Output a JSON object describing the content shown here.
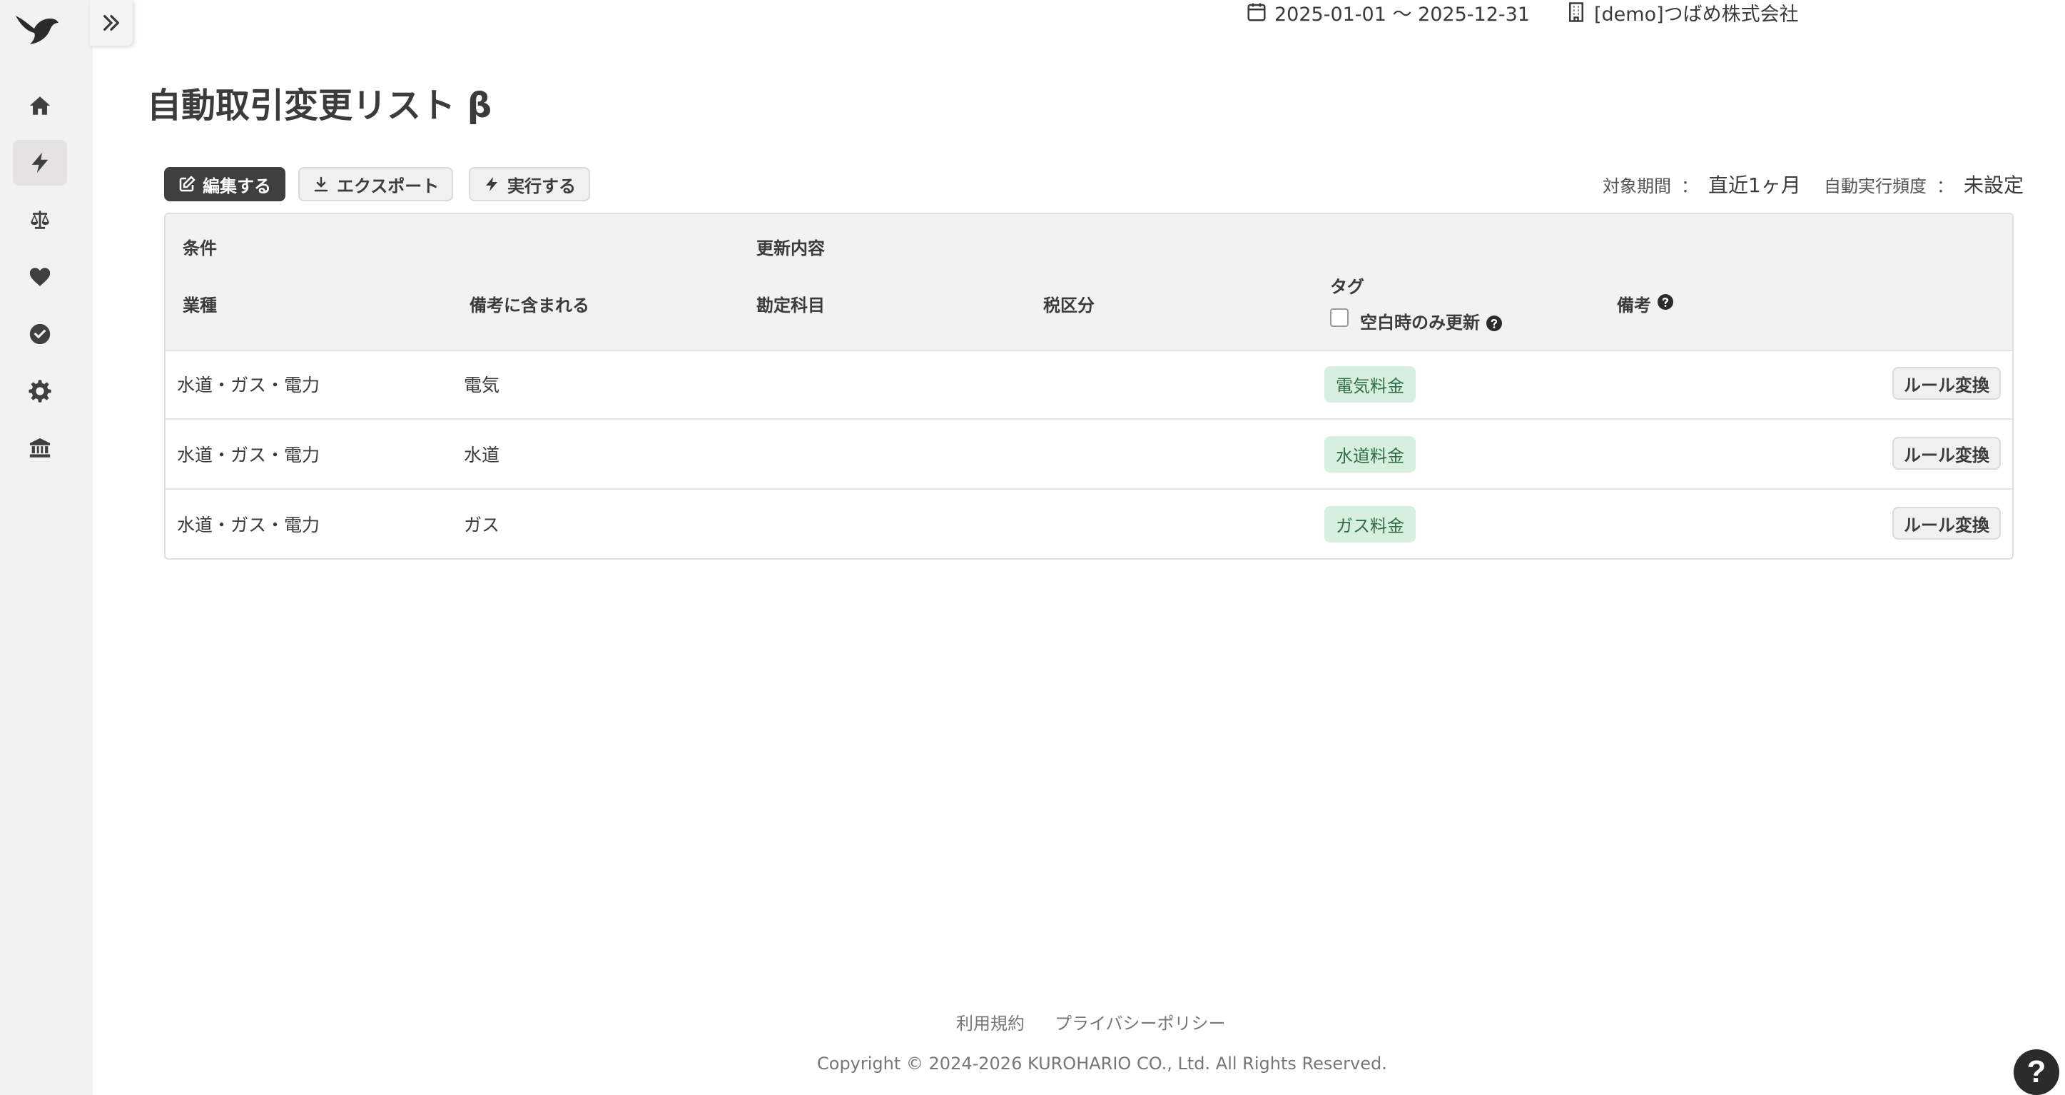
{
  "header": {
    "period": "2025-01-01 〜 2025-12-31",
    "company": "[demo]つばめ株式会社"
  },
  "sidebar": {
    "items": [
      {
        "icon": "home-icon"
      },
      {
        "icon": "lightning-icon",
        "active": true
      },
      {
        "icon": "scale-icon"
      },
      {
        "icon": "heart-icon"
      },
      {
        "icon": "check-circle-icon"
      },
      {
        "icon": "gear-icon"
      },
      {
        "icon": "bank-icon"
      }
    ]
  },
  "page": {
    "title": "自動取引変更リスト β"
  },
  "toolbar": {
    "edit_label": "編集する",
    "export_label": "エクスポート",
    "run_label": "実行する"
  },
  "meta": {
    "period_label": "対象期間",
    "period_sep": "：",
    "period_value": "直近1ヶ月",
    "freq_label": "自動実行頻度",
    "freq_sep": "：",
    "freq_value": "未設定"
  },
  "table": {
    "group_condition": "条件",
    "group_update": "更新内容",
    "col_industry": "業種",
    "col_memo_contains": "備考に含まれる",
    "col_account": "勘定科目",
    "col_tax": "税区分",
    "col_tag": "タグ",
    "col_tag_option": "空白時のみ更新",
    "col_memo": "備考",
    "rows": [
      {
        "industry": "水道・ガス・電力",
        "memo_contains": "電気",
        "tag": "電気料金",
        "action": "ルール変換"
      },
      {
        "industry": "水道・ガス・電力",
        "memo_contains": "水道",
        "tag": "水道料金",
        "action": "ルール変換"
      },
      {
        "industry": "水道・ガス・電力",
        "memo_contains": "ガス",
        "tag": "ガス料金",
        "action": "ルール変換"
      }
    ]
  },
  "footer": {
    "terms": "利用規約",
    "privacy": "プライバシーポリシー",
    "copyright": "Copyright © 2024-2026 KUROHARIO CO., Ltd. All Rights Reserved."
  },
  "help": {
    "label": "?"
  }
}
